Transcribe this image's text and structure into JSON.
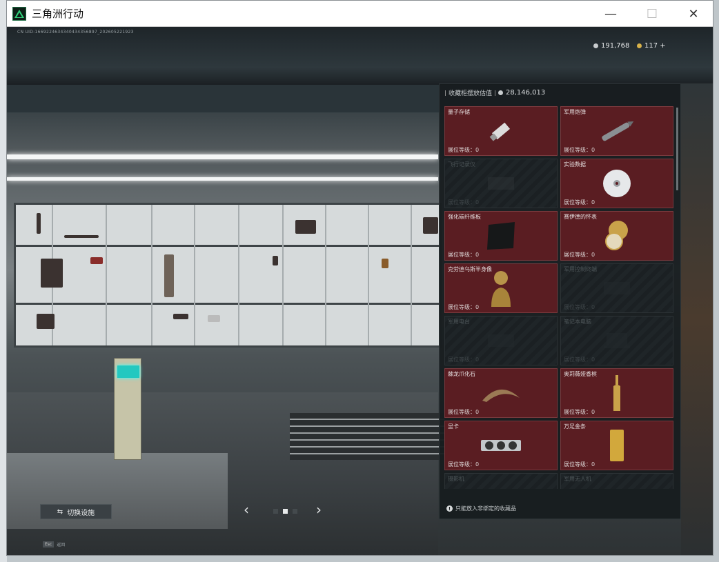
{
  "window": {
    "title": "三角洲行动",
    "minimize": "—",
    "maximize": "☐",
    "close": "✕"
  },
  "hud": {
    "session_id": "CN UID:1669224634340434356897_202605221923",
    "currency_silver": "191,768",
    "currency_gold": "117 +"
  },
  "panel": {
    "title": "收藏柜摆放估值",
    "value": "28,146,013",
    "footer": "只能放入非绑定的收藏品"
  },
  "items": [
    {
      "name": "量子存储",
      "level": "展位等级：0",
      "filled": true,
      "icon": "usb-drive-icon"
    },
    {
      "name": "军用炮弹",
      "level": "展位等级：0",
      "filled": true,
      "icon": "artillery-shell-icon"
    },
    {
      "name": "飞行记录仪",
      "level": "展位等级：0",
      "filled": false,
      "icon": "flight-recorder-icon"
    },
    {
      "name": "实验数据",
      "level": "展位等级：0",
      "filled": true,
      "icon": "disc-icon"
    },
    {
      "name": "强化碳纤维板",
      "level": "展位等级：0",
      "filled": true,
      "icon": "carbon-plate-icon"
    },
    {
      "name": "赛伊德的怀表",
      "level": "展位等级：0",
      "filled": true,
      "icon": "pocket-watch-icon"
    },
    {
      "name": "克劳迪乌斯半身像",
      "level": "展位等级：0",
      "filled": true,
      "icon": "bust-icon"
    },
    {
      "name": "军用控制终端",
      "level": "展位等级：0",
      "filled": false,
      "icon": "control-terminal-icon"
    },
    {
      "name": "军用电台",
      "level": "展位等级：0",
      "filled": false,
      "icon": "radio-icon"
    },
    {
      "name": "笔记本电脑",
      "level": "展位等级：0",
      "filled": false,
      "icon": "laptop-icon"
    },
    {
      "name": "棘龙爪化石",
      "level": "展位等级：0",
      "filled": true,
      "icon": "claw-fossil-icon"
    },
    {
      "name": "奥莉薇娅香槟",
      "level": "展位等级：0",
      "filled": true,
      "icon": "champagne-icon"
    },
    {
      "name": "显卡",
      "level": "展位等级：0",
      "filled": true,
      "icon": "gpu-icon"
    },
    {
      "name": "万足金条",
      "level": "展位等级：0",
      "filled": true,
      "icon": "gold-bar-icon"
    },
    {
      "name": "摄影机",
      "level": "",
      "filled": false,
      "icon": "camera-icon"
    },
    {
      "name": "军用无人机",
      "level": "",
      "filled": false,
      "icon": "drone-icon"
    }
  ],
  "controls": {
    "switch_facility": "切换设施",
    "prev": "‹",
    "next": "›",
    "esc_key": "Esc",
    "esc_label": "返回"
  },
  "colors": {
    "card_filled": "#5a1d22",
    "panel_bg": "#171c1f",
    "accent_teal": "#23c8c0"
  }
}
